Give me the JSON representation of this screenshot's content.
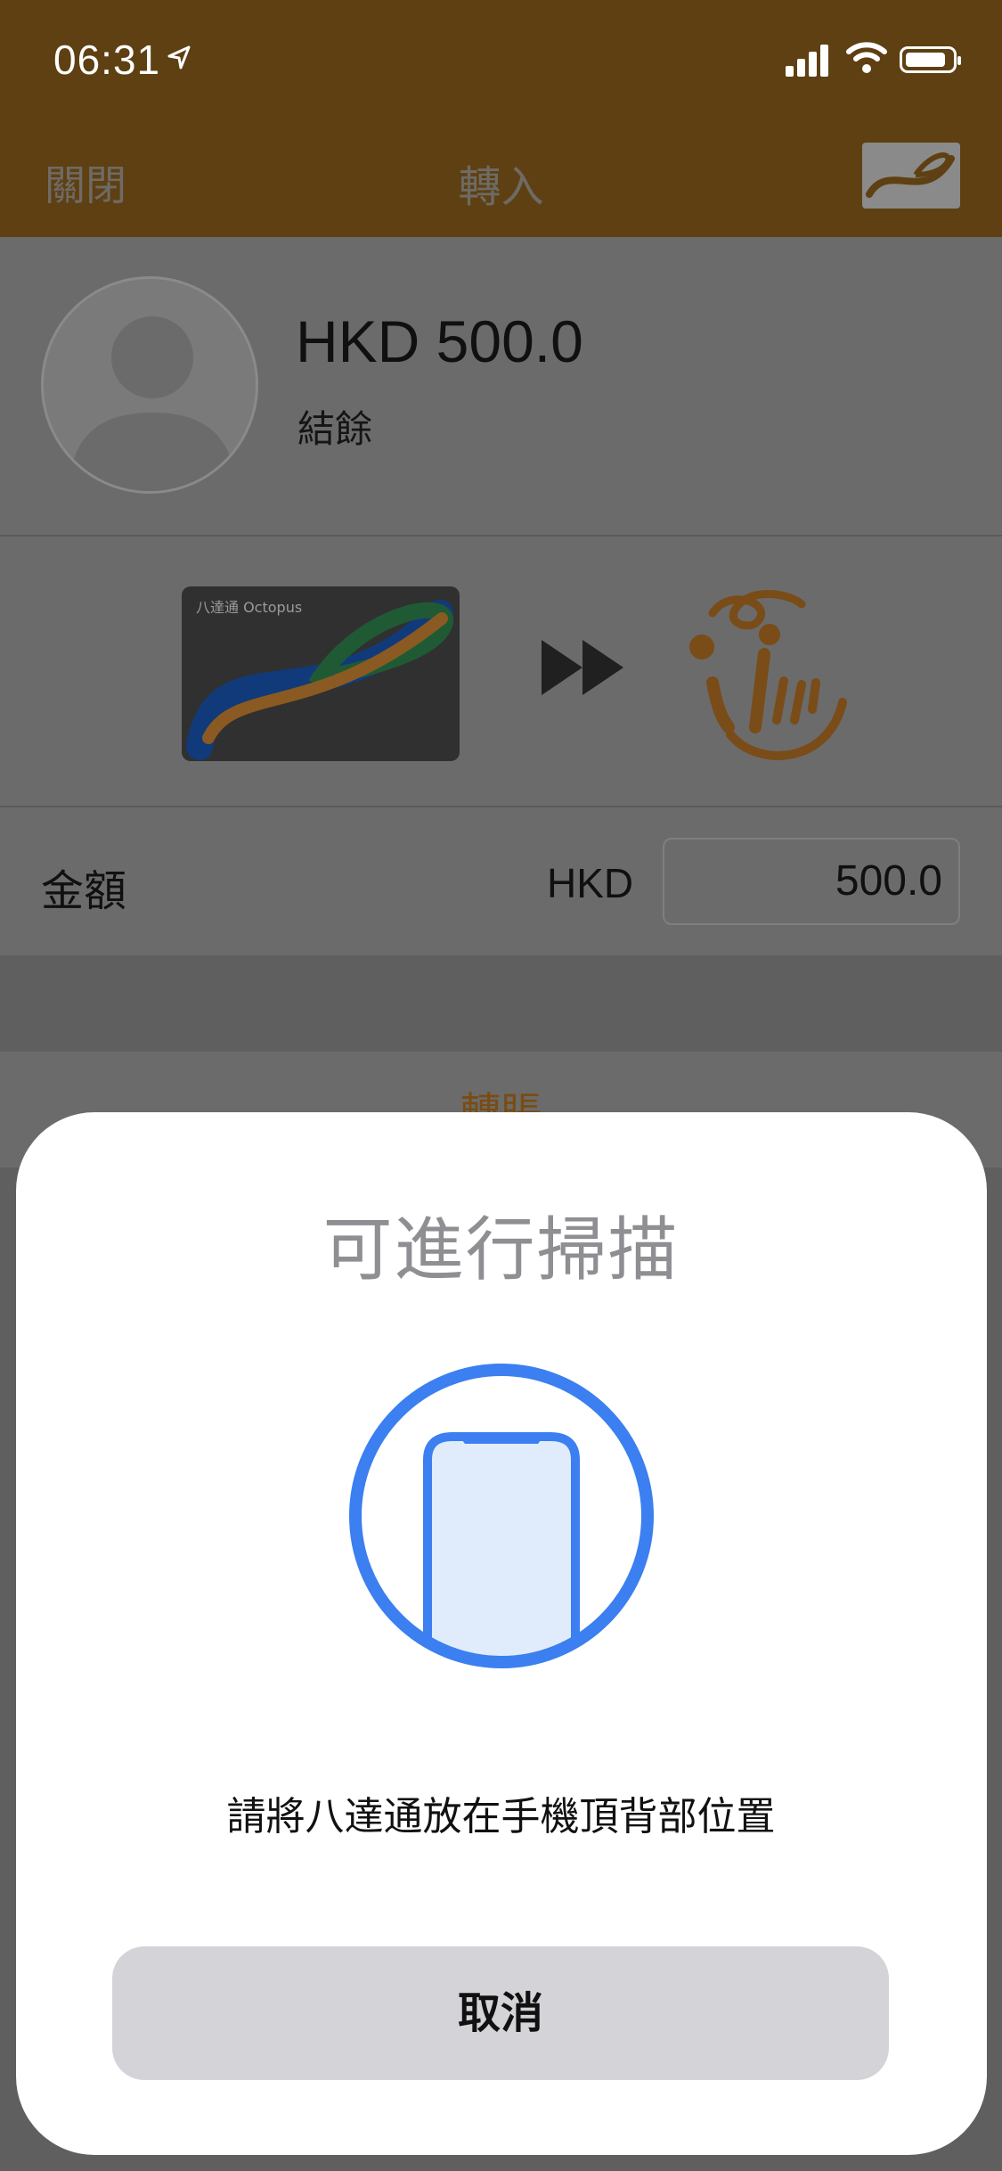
{
  "status_bar": {
    "time": "06:31",
    "location_icon": "location-arrow-icon",
    "signal_icon": "cellular-signal-icon",
    "wifi_icon": "wifi-icon",
    "battery_icon": "battery-icon"
  },
  "nav": {
    "close_label": "關閉",
    "title": "轉入",
    "logo_icon": "octopus-logo-icon"
  },
  "balance": {
    "amount": "HKD 500.0",
    "label": "結餘"
  },
  "transfer_visual": {
    "card_label": "八達通 Octopus",
    "arrow_icon": "fast-forward-icon",
    "mascot_icon": "octopus-mascot-icon"
  },
  "amount_row": {
    "label": "金額",
    "currency": "HKD",
    "value": "500.0"
  },
  "action": {
    "transfer_label": "轉賬"
  },
  "scan_sheet": {
    "title": "可進行掃描",
    "icon": "phone-scan-icon",
    "instruction": "請將八達通放在手機頂背部位置",
    "cancel_label": "取消"
  },
  "colors": {
    "header_bg": "#5f4012",
    "accent_blue": "#3b7ff0",
    "octopus_orange": "#b5712a",
    "sheet_bg": "#ffffff",
    "cancel_bg": "#d4d4d8"
  }
}
